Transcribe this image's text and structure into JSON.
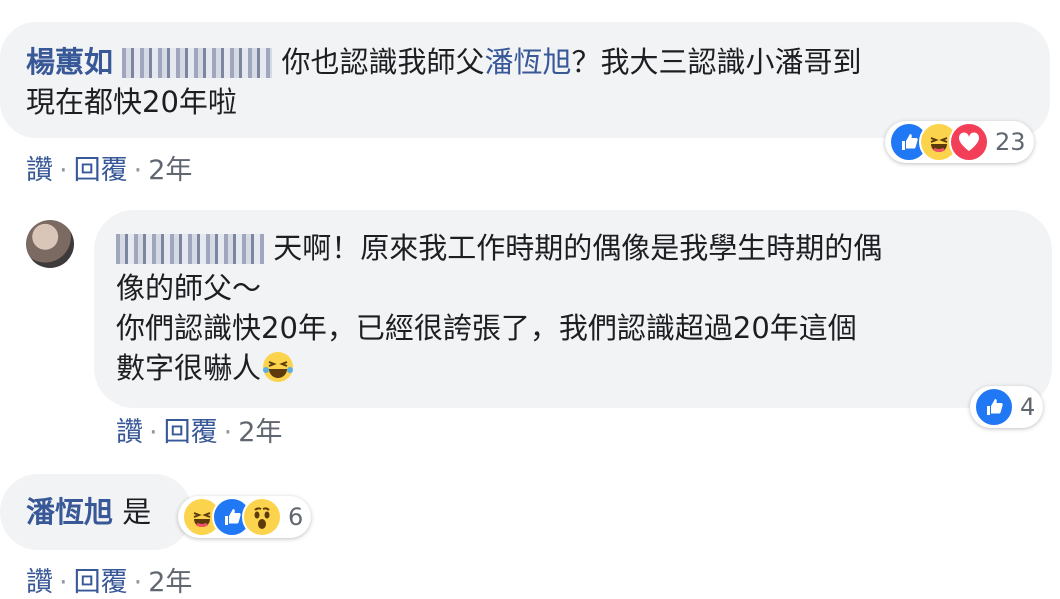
{
  "comments": [
    {
      "author": "楊蕙如",
      "text_tag": "你也認識我師父",
      "tag_name": "潘恆旭",
      "text_line1_rest": "？我大三認識小潘哥到",
      "text_line2": "現在都快20年啦",
      "reaction_count": "23",
      "actions": {
        "like": "讚",
        "reply": "回覆",
        "time": "2年"
      }
    },
    {
      "line1": "天啊！原來我工作時期的偶像是我學生時期的偶",
      "line2": "像的師父～",
      "line3": "你們認識快20年，已經很誇張了，我們認識超過20年這個",
      "line4": "數字很嚇人",
      "reaction_count": "4",
      "actions": {
        "like": "讚",
        "reply": "回覆",
        "time": "2年"
      }
    },
    {
      "author": "潘恆旭",
      "text": "是",
      "reaction_count": "6",
      "actions": {
        "like": "讚",
        "reply": "回覆",
        "time": "2年"
      }
    }
  ],
  "icons": {
    "like": "thumbs-up-icon",
    "haha": "laughing-face-icon",
    "love": "heart-icon",
    "wow": "surprised-face-icon",
    "inline_emoji": "laughing-with-tears-emoji"
  },
  "colors": {
    "link": "#385898",
    "bubble": "#f2f3f5",
    "like_blue": "#2078f4",
    "love_red": "#f33e58",
    "haha_yellow": "#fcd34d"
  }
}
